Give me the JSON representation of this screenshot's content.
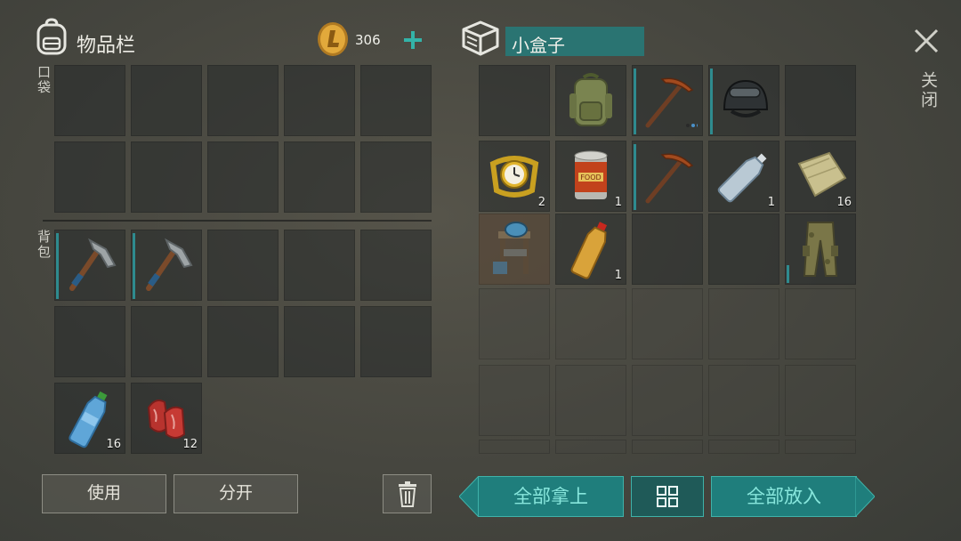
{
  "inventory": {
    "title": "物品栏",
    "coins": "306",
    "pocket_label": "口袋",
    "backpack_label": "背包",
    "bottle_qty": "16",
    "meat_qty": "12"
  },
  "container": {
    "title": "小盒子",
    "watch_qty": "2",
    "can_qty": "1",
    "water_qty": "1",
    "cloth_qty": "16",
    "juice_qty": "1"
  },
  "close_label": "关闭",
  "buttons": {
    "use": "使用",
    "split": "分开",
    "take_all": "全部拿上",
    "put_all": "全部放入"
  },
  "colors": {
    "accent": "#1f7e7c",
    "accent_text": "#87e6dc",
    "durability": "#2e8b8f"
  }
}
